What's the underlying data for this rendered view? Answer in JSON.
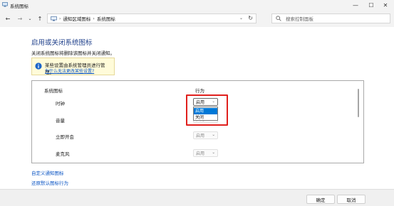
{
  "window": {
    "title": "系统图标",
    "minimize_glyph": "—",
    "maximize_glyph": "☐",
    "close_glyph": "✕"
  },
  "nav": {
    "back_glyph": "←",
    "forward_glyph": "→",
    "recent_glyph": "⌄",
    "up_glyph": "↑",
    "breadcrumb": [
      "通知区域图标",
      "系统图标"
    ],
    "breadcrumb_sep": "›",
    "dropdown_glyph": "⌄",
    "refresh_glyph": "↻",
    "search_placeholder": "搜索控制面板"
  },
  "main": {
    "title": "启用或关闭系统图标",
    "description": "关闭系统图标将删除该图标并关闭通知。",
    "info": {
      "text": "某些设置由系统管理员进行管理。",
      "link": "为什么无法更改某些设置?"
    },
    "table": {
      "col_icon": "系统图标",
      "col_behavior": "行为",
      "rows": [
        {
          "name": "时钟",
          "value": "启用"
        },
        {
          "name": "音量",
          "value": "启用"
        },
        {
          "name": "立即开会",
          "value": "启用"
        },
        {
          "name": "麦克风",
          "value": "启用"
        }
      ],
      "dropdown_open_options": [
        "启用",
        "关闭"
      ],
      "dropdown_chevron": "⌄"
    },
    "links": {
      "customize": "自定义通知图标",
      "restore": "还原默认图标行为"
    }
  },
  "buttons": {
    "ok": "确定",
    "cancel": "取消"
  },
  "colors": {
    "title_blue": "#1e3f8a",
    "link_blue": "#0b55c4",
    "highlight_red": "#e0201d",
    "selection_blue": "#0078d7",
    "info_bg": "#fffbd9"
  }
}
